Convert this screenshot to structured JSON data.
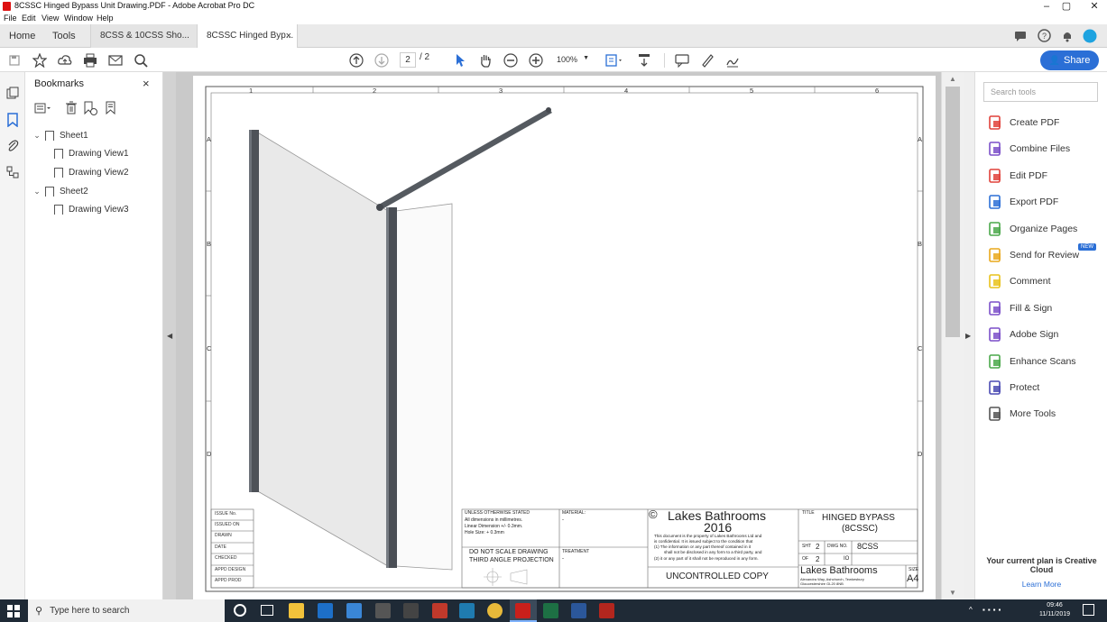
{
  "window": {
    "title": "8CSSC Hinged Bypass Unit Drawing.PDF - Adobe Acrobat Pro DC",
    "min": "–",
    "max": "▢",
    "close": "✕"
  },
  "menu": [
    "File",
    "Edit",
    "View",
    "Window",
    "Help"
  ],
  "tabs": {
    "home": "Home",
    "tools": "Tools",
    "doc1": "8CSS & 10CSS Sho...",
    "doc2": "8CSSC Hinged Byp...",
    "close": "×"
  },
  "toolbar": {
    "page_current": "2",
    "page_total": "/ 2",
    "zoom": "100%",
    "share_label": "Share"
  },
  "bookmarks": {
    "header": "Bookmarks",
    "close": "×",
    "items": [
      {
        "label": "Sheet1",
        "level": 0,
        "expanded": true
      },
      {
        "label": "Drawing View1",
        "level": 1
      },
      {
        "label": "Drawing View2",
        "level": 1
      },
      {
        "label": "Sheet2",
        "level": 0,
        "expanded": true
      },
      {
        "label": "Drawing View3",
        "level": 1
      }
    ]
  },
  "tools_panel": {
    "search_placeholder": "Search tools",
    "items": [
      {
        "label": "Create PDF",
        "icon": "create-pdf-icon",
        "color": "#e0413a"
      },
      {
        "label": "Combine Files",
        "icon": "combine-files-icon",
        "color": "#7b4fc9"
      },
      {
        "label": "Edit PDF",
        "icon": "edit-pdf-icon",
        "color": "#e0413a"
      },
      {
        "label": "Export PDF",
        "icon": "export-pdf-icon",
        "color": "#2b6fd6"
      },
      {
        "label": "Organize Pages",
        "icon": "organize-pages-icon",
        "color": "#4aa84a"
      },
      {
        "label": "Send for Review",
        "icon": "send-review-icon",
        "color": "#e9a81b"
      },
      {
        "label": "Comment",
        "icon": "comment-icon",
        "color": "#e9c21b"
      },
      {
        "label": "Fill & Sign",
        "icon": "fill-sign-icon",
        "color": "#7b4fc9"
      },
      {
        "label": "Adobe Sign",
        "icon": "adobe-sign-icon",
        "color": "#7b4fc9"
      },
      {
        "label": "Enhance Scans",
        "icon": "enhance-scans-icon",
        "color": "#4aa84a"
      },
      {
        "label": "Protect",
        "icon": "protect-icon",
        "color": "#4a4ab3"
      },
      {
        "label": "More Tools",
        "icon": "more-tools-icon",
        "color": "#555555"
      }
    ],
    "new_badge": "NEW",
    "plan_text": "Your current plan is Creative Cloud",
    "learn_more": "Learn More"
  },
  "drawing": {
    "col_numbers": [
      "1",
      "2",
      "3",
      "4",
      "5",
      "6"
    ],
    "row_letters": [
      "A",
      "B",
      "C",
      "D"
    ],
    "revision_labels": [
      "ISSUE No.",
      "ISSUED ON",
      "DRAWN",
      "DATE",
      "CHECKED",
      "APPD DESIGN",
      "APPD PROD"
    ],
    "unless_stated": "UNLESS OTHERWISE STATED",
    "dims_line1": "All dimensions in millimetres.",
    "dims_line2": "Linear Dimension +/- 0.3mm.",
    "dims_line3": "Hole Size: + 0.3mm",
    "do_not_scale": "DO NOT SCALE DRAWING",
    "third_angle": "THIRD ANGLE PROJECTION",
    "material_label": "MATERIAL:",
    "material_value": "-",
    "treatment_label": "TREATMENT",
    "treatment_value": "-",
    "copyright_sym": "©",
    "company": "Lakes Bathrooms",
    "year": "2016",
    "confidential_1": "This document is the property of Lakes Bathrooms Ltd and",
    "confidential_2": "is confidential. It is issued subject to the condition that",
    "confidential_3": "(1) The information or any part thereof contained in it",
    "confidential_4": "shall not be disclosed in any form to a third party, and",
    "confidential_5": "(2) it or any part of it shall not be reproduced in any form.",
    "uncontrolled": "UNCONTROLLED COPY",
    "title_label": "TITLE",
    "title_line1": "HINGED BYPASS",
    "title_line2": "(8CSSC)",
    "sht_label": "SHT",
    "sht_value": "2",
    "dwg_label": "DWG NO.",
    "dwg_value": "8CSS",
    "of_label": "OF",
    "of_value": "2",
    "io_value": "IO",
    "footer_company": "Lakes Bathrooms",
    "footer_address": "Alexandra Way, Ashchurch, Tewkesbury",
    "footer_address2": "Gloucestershire GL20 8NB",
    "size_label": "SIZE",
    "size_value": "A4"
  },
  "taskbar": {
    "search_placeholder": "Type here to search",
    "time": "09:46",
    "date": "11/11/2019"
  }
}
